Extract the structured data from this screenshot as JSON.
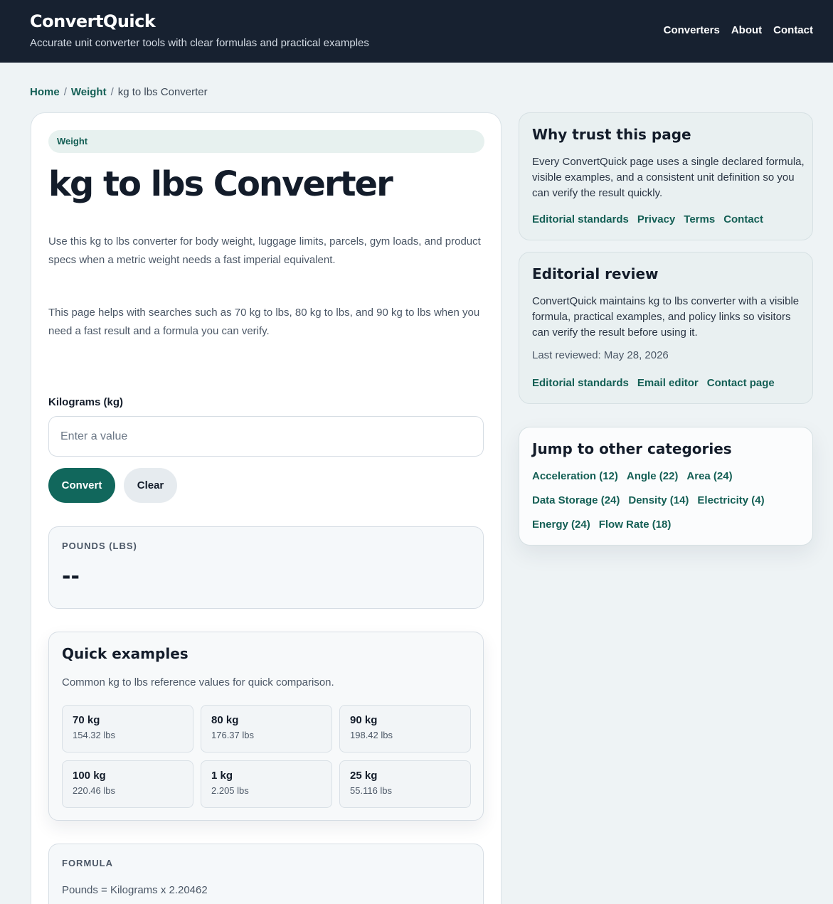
{
  "header": {
    "brand": "ConvertQuick",
    "tagline": "Accurate unit converter tools with clear formulas and practical examples",
    "nav": [
      "Converters",
      "About",
      "Contact"
    ]
  },
  "breadcrumb": {
    "home": "Home",
    "category": "Weight",
    "current": "kg to lbs Converter"
  },
  "main": {
    "category_pill": "Weight",
    "title": "kg to lbs Converter",
    "intro_1": "Use this kg to lbs converter for body weight, luggage limits, parcels, gym loads, and product specs when a metric weight needs a fast imperial equivalent.",
    "intro_2": "This page helps with searches such as 70 kg to lbs, 80 kg to lbs, and 90 kg to lbs when you need a fast result and a formula you can verify.",
    "input_label": "Kilograms (kg)",
    "input_placeholder": "Enter a value",
    "input_value": "",
    "convert_label": "Convert",
    "clear_label": "Clear",
    "result_label": "POUNDS (LBS)",
    "result_value": "--",
    "examples": {
      "title": "Quick examples",
      "description": "Common kg to lbs reference values for quick comparison.",
      "items": [
        {
          "kg": "70 kg",
          "lbs": "154.32 lbs"
        },
        {
          "kg": "80 kg",
          "lbs": "176.37 lbs"
        },
        {
          "kg": "90 kg",
          "lbs": "198.42 lbs"
        },
        {
          "kg": "100 kg",
          "lbs": "220.46 lbs"
        },
        {
          "kg": "1 kg",
          "lbs": "2.205 lbs"
        },
        {
          "kg": "25 kg",
          "lbs": "55.116 lbs"
        }
      ]
    },
    "formula_label": "FORMULA",
    "formula_text": "Pounds = Kilograms x 2.20462"
  },
  "sidebar": {
    "trust": {
      "title": "Why trust this page",
      "text": "Every ConvertQuick page uses a single declared formula, visible examples, and a consistent unit definition so you can verify the result quickly.",
      "links": [
        "Editorial standards",
        "Privacy",
        "Terms",
        "Contact"
      ]
    },
    "review": {
      "title": "Editorial review",
      "text": "ConvertQuick maintains kg to lbs converter with a visible formula, practical examples, and policy links so visitors can verify the result before using it.",
      "last_reviewed": "Last reviewed: May 28, 2026",
      "links": [
        "Editorial standards",
        "Email editor",
        "Contact page"
      ]
    },
    "jump": {
      "title": "Jump to other categories",
      "categories": [
        "Acceleration (12)",
        "Angle (22)",
        "Area (24)",
        "Data Storage (24)",
        "Density (14)",
        "Electricity (4)",
        "Energy (24)",
        "Flow Rate (18)"
      ]
    }
  },
  "colors": {
    "header_bg": "#172130",
    "accent": "#11675c",
    "link": "#145f55",
    "page_bg": "#eef3f5"
  }
}
